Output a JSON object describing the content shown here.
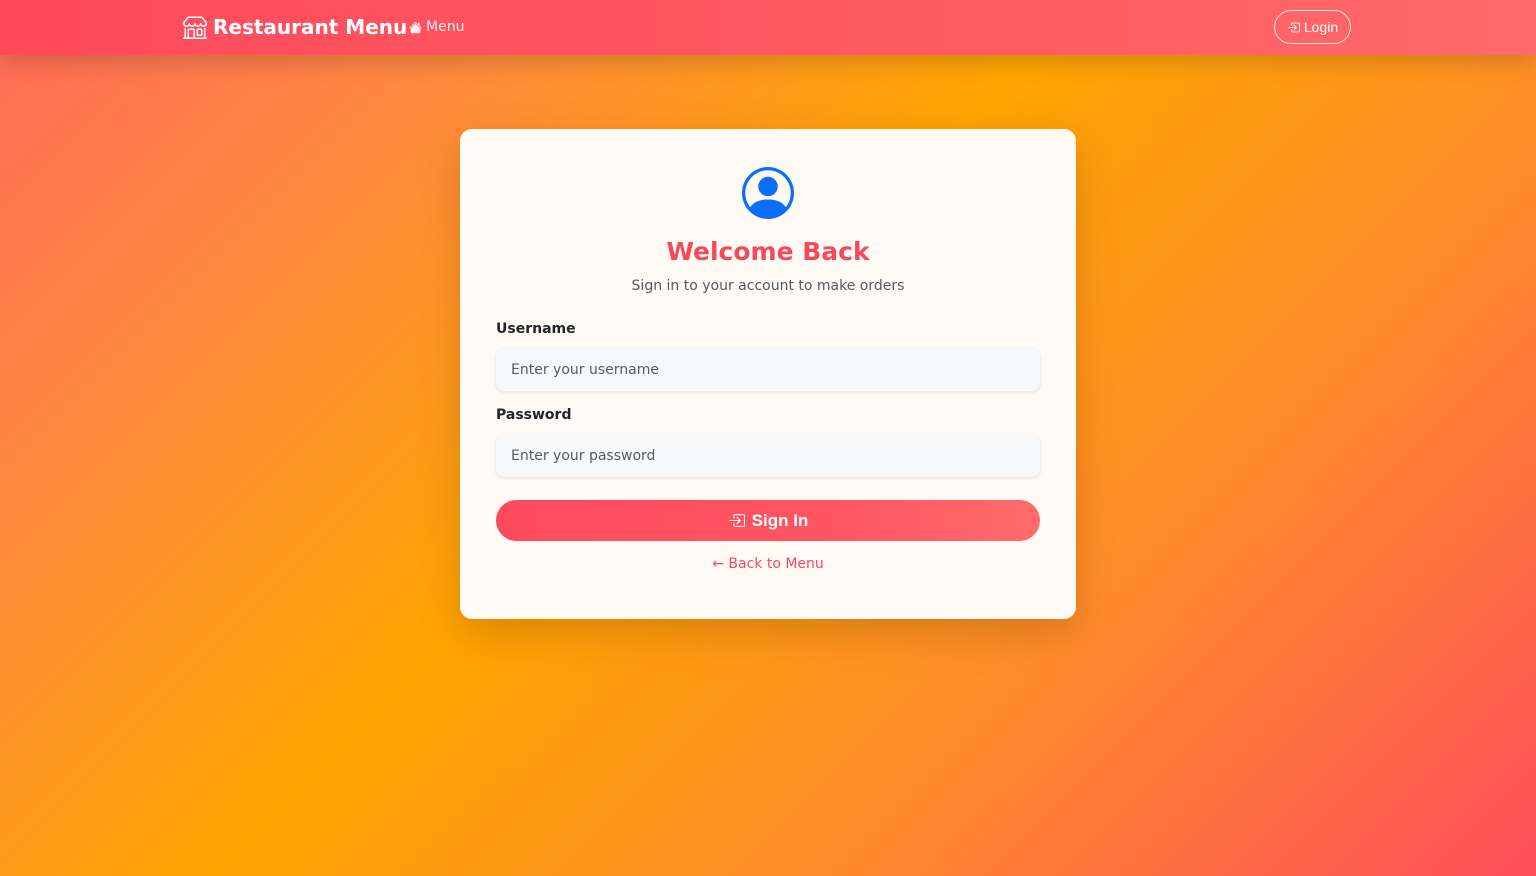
{
  "navbar": {
    "brand": "Restaurant Menu",
    "brand_icon": "shop-icon",
    "menu_link": "Menu",
    "menu_icon": "house-icon",
    "login_label": "Login",
    "login_icon": "box-arrow-in-right-icon"
  },
  "login_card": {
    "avatar_icon": "person-circle-icon",
    "title": "Welcome Back",
    "subtitle": "Sign in to your account to make orders",
    "username_label": "Username",
    "username_placeholder": "Enter your username",
    "username_value": "",
    "password_label": "Password",
    "password_placeholder": "Enter your password",
    "password_value": "",
    "submit_label": "Sign In",
    "back_link": "← Back to Menu"
  },
  "colors": {
    "accent": "#f5495d",
    "avatar": "#0d6efd",
    "card_bg": "#fffaf3"
  }
}
